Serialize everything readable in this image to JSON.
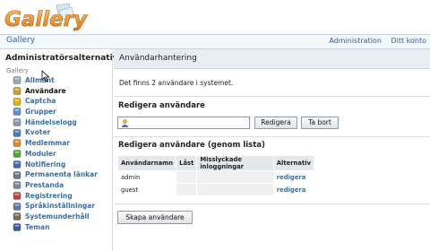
{
  "logo_text": "Gallery",
  "topbar": {
    "breadcrumb": "Gallery",
    "links": [
      "Administration",
      "Ditt konto"
    ]
  },
  "sidebar": {
    "title": "Administratörsalternativ",
    "group": "Gallery",
    "items": [
      {
        "label": "Allmänt",
        "icon": "general-icon",
        "color": "#9aa7b5"
      },
      {
        "label": "Användare",
        "icon": "users-icon",
        "color": "#c99a4a",
        "active": true
      },
      {
        "label": "Captcha",
        "icon": "shield-icon",
        "color": "#e0b020"
      },
      {
        "label": "Grupper",
        "icon": "groups-icon",
        "color": "#5a8fc8"
      },
      {
        "label": "Händelselogg",
        "icon": "log-icon",
        "color": "#8a9aaa"
      },
      {
        "label": "Kvoter",
        "icon": "quota-icon",
        "color": "#4a7ab8"
      },
      {
        "label": "Medlemmar",
        "icon": "members-icon",
        "color": "#d08a3a"
      },
      {
        "label": "Moduler",
        "icon": "puzzle-icon",
        "color": "#5aa040"
      },
      {
        "label": "Notifiering",
        "icon": "mail-icon",
        "color": "#4a6ab0"
      },
      {
        "label": "Permanenta länkar",
        "icon": "anchor-icon",
        "color": "#6a7a8a"
      },
      {
        "label": "Prestanda",
        "icon": "gauge-icon",
        "color": "#7a8a9a"
      },
      {
        "label": "Registrering",
        "icon": "register-icon",
        "color": "#c04040"
      },
      {
        "label": "Språkinställningar",
        "icon": "language-icon",
        "color": "#5a7ab0"
      },
      {
        "label": "Systemunderhåll",
        "icon": "maintenance-icon",
        "color": "#7a6a5a"
      },
      {
        "label": "Teman",
        "icon": "themes-icon",
        "color": "#3a5a9a"
      }
    ]
  },
  "main": {
    "title": "Användarhantering",
    "info": "Det finns 2 användare i systemet.",
    "edit_heading": "Redigera användare",
    "edit_input_value": "",
    "edit_button": "Redigera",
    "delete_button": "Ta bort",
    "list_heading": "Redigera användare (genom lista)",
    "table": {
      "columns": [
        "Användarnamn",
        "Låst",
        "Misslyckade inloggningar",
        "Alternativ"
      ],
      "rows": [
        {
          "username": "admin",
          "locked": "",
          "failed": "",
          "action": "redigera"
        },
        {
          "username": "guest",
          "locked": "",
          "failed": "",
          "action": "redigera"
        }
      ]
    },
    "create_button": "Skapa användare"
  }
}
